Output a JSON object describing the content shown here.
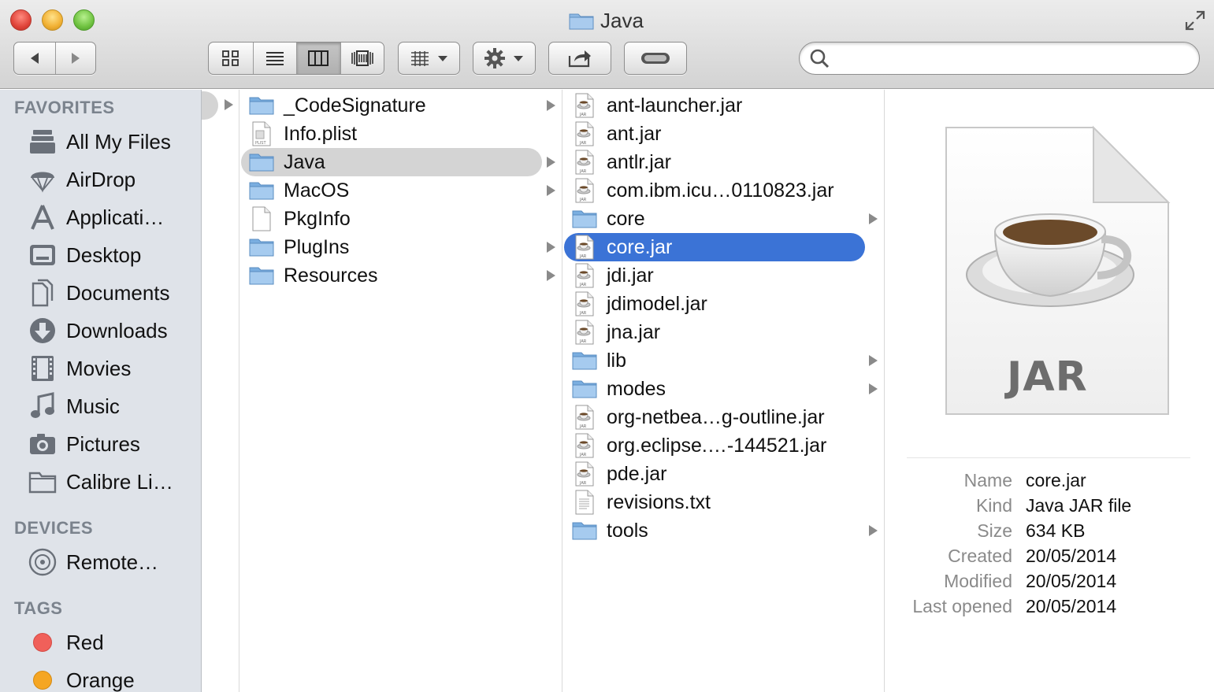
{
  "window": {
    "title": "Java"
  },
  "toolbar": {
    "search_placeholder": "",
    "view_modes": [
      "icon",
      "list",
      "column",
      "cover-flow"
    ],
    "active_view": "column"
  },
  "sidebar": {
    "favorites_header": "FAVORITES",
    "favorites": [
      {
        "label": "All My Files",
        "icon": "all-my-files-icon"
      },
      {
        "label": "AirDrop",
        "icon": "airdrop-icon"
      },
      {
        "label": "Applicati…",
        "icon": "applications-icon"
      },
      {
        "label": "Desktop",
        "icon": "desktop-icon"
      },
      {
        "label": "Documents",
        "icon": "documents-icon"
      },
      {
        "label": "Downloads",
        "icon": "downloads-icon"
      },
      {
        "label": "Movies",
        "icon": "movies-icon"
      },
      {
        "label": "Music",
        "icon": "music-icon"
      },
      {
        "label": "Pictures",
        "icon": "pictures-icon"
      },
      {
        "label": "Calibre Li…",
        "icon": "folder-icon"
      }
    ],
    "devices_header": "DEVICES",
    "devices": [
      {
        "label": "Remote…",
        "icon": "remote-disc-icon"
      }
    ],
    "tags_header": "TAGS",
    "tags": [
      {
        "label": "Red",
        "color": "#f0605a"
      },
      {
        "label": "Orange",
        "color": "#f5a623"
      }
    ]
  },
  "column2": {
    "items": [
      {
        "name": "_CodeSignature",
        "kind": "folder",
        "has_children": true
      },
      {
        "name": "Info.plist",
        "kind": "plist",
        "has_children": false
      },
      {
        "name": "Java",
        "kind": "folder",
        "has_children": true,
        "selected": true
      },
      {
        "name": "MacOS",
        "kind": "folder",
        "has_children": true
      },
      {
        "name": "PkgInfo",
        "kind": "file",
        "has_children": false
      },
      {
        "name": "PlugIns",
        "kind": "folder",
        "has_children": true
      },
      {
        "name": "Resources",
        "kind": "folder",
        "has_children": true
      }
    ]
  },
  "column3": {
    "items": [
      {
        "name": "ant-launcher.jar",
        "kind": "jar",
        "has_children": false
      },
      {
        "name": "ant.jar",
        "kind": "jar",
        "has_children": false
      },
      {
        "name": "antlr.jar",
        "kind": "jar",
        "has_children": false
      },
      {
        "name": "com.ibm.icu…0110823.jar",
        "kind": "jar",
        "has_children": false
      },
      {
        "name": "core",
        "kind": "folder",
        "has_children": true
      },
      {
        "name": "core.jar",
        "kind": "jar",
        "has_children": false,
        "selected": true
      },
      {
        "name": "jdi.jar",
        "kind": "jar",
        "has_children": false
      },
      {
        "name": "jdimodel.jar",
        "kind": "jar",
        "has_children": false
      },
      {
        "name": "jna.jar",
        "kind": "jar",
        "has_children": false
      },
      {
        "name": "lib",
        "kind": "folder",
        "has_children": true
      },
      {
        "name": "modes",
        "kind": "folder",
        "has_children": true
      },
      {
        "name": "org-netbea…g-outline.jar",
        "kind": "jar",
        "has_children": false
      },
      {
        "name": "org.eclipse.…-144521.jar",
        "kind": "jar",
        "has_children": false
      },
      {
        "name": "pde.jar",
        "kind": "jar",
        "has_children": false
      },
      {
        "name": "revisions.txt",
        "kind": "text",
        "has_children": false
      },
      {
        "name": "tools",
        "kind": "folder",
        "has_children": true
      }
    ]
  },
  "preview": {
    "icon_label": "JAR",
    "info": [
      {
        "key": "Name",
        "value": "core.jar"
      },
      {
        "key": "Kind",
        "value": "Java JAR file"
      },
      {
        "key": "Size",
        "value": "634 KB"
      },
      {
        "key": "Created",
        "value": "20/05/2014"
      },
      {
        "key": "Modified",
        "value": "20/05/2014"
      },
      {
        "key": "Last opened",
        "value": "20/05/2014"
      }
    ]
  },
  "colors": {
    "selection_active": "#3b73d6",
    "selection_inactive": "#d4d4d4",
    "sidebar_bg": "#dfe3e9",
    "folder_blue": "#8fb9e3"
  }
}
